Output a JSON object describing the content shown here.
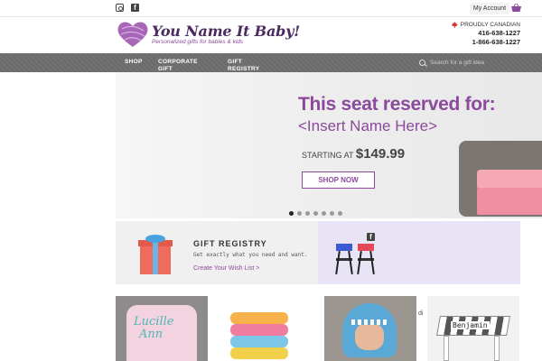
{
  "topbar": {
    "social": [
      "instagram-icon",
      "facebook-icon"
    ],
    "account_label": "My Account",
    "cart_icon": "basket-icon"
  },
  "header": {
    "brand_name": "You Name It Baby!",
    "tagline": "Personalized gifts for babies & kids",
    "proud": "PROUDLY CANADIAN",
    "phone1": "416-638-1227",
    "phone2": "1-866-638-1227"
  },
  "nav": {
    "items": [
      "SHOP",
      "CORPORATE GIFT",
      "GIFT REGISTRY"
    ],
    "search_placeholder": "Search for a gift idea"
  },
  "hero": {
    "title": "This seat reserved for:",
    "subtitle": "<Insert Name Here>",
    "price_label": "STARTING AT",
    "price": "$149.99",
    "cta": "SHOP NOW",
    "slides": 7,
    "active_slide": 1
  },
  "gift_registry": {
    "title": "GIFT REGISTRY",
    "text": "Get exactly what you need and want.",
    "link": "Create Your Wish List >"
  },
  "promo": {
    "icon": "facebook-icon"
  },
  "products": {
    "bag_text_line1": "Lucille",
    "bag_text_line2": "Ann",
    "stool_name": "Benjamin",
    "side_fragment": "di"
  },
  "colors": {
    "accent": "#8c4a9c",
    "nav_bg": "#6b6b6b",
    "promo_bg": "#e9e4f5"
  }
}
